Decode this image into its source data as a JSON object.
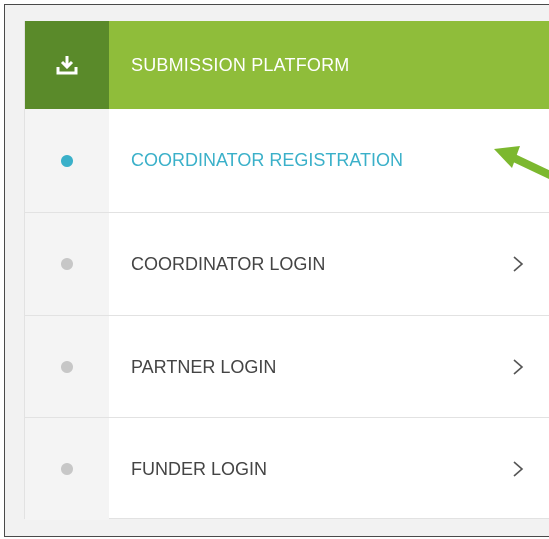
{
  "header": {
    "title": "SUBMISSION PLATFORM",
    "icon": "download-icon",
    "icon_bg": "#5a8a2a",
    "bg": "#8fbd3a"
  },
  "menu": {
    "items": [
      {
        "label": "COORDINATOR REGISTRATION",
        "active": true
      },
      {
        "label": "COORDINATOR LOGIN",
        "active": false
      },
      {
        "label": "PARTNER LOGIN",
        "active": false
      },
      {
        "label": "FUNDER LOGIN",
        "active": false
      }
    ]
  },
  "colors": {
    "active_text": "#3ab0c9",
    "inactive_bullet": "#c7c7c7",
    "annotation_arrow": "#7cb82f"
  },
  "annotation": {
    "icon": "pointer-arrow-icon"
  }
}
